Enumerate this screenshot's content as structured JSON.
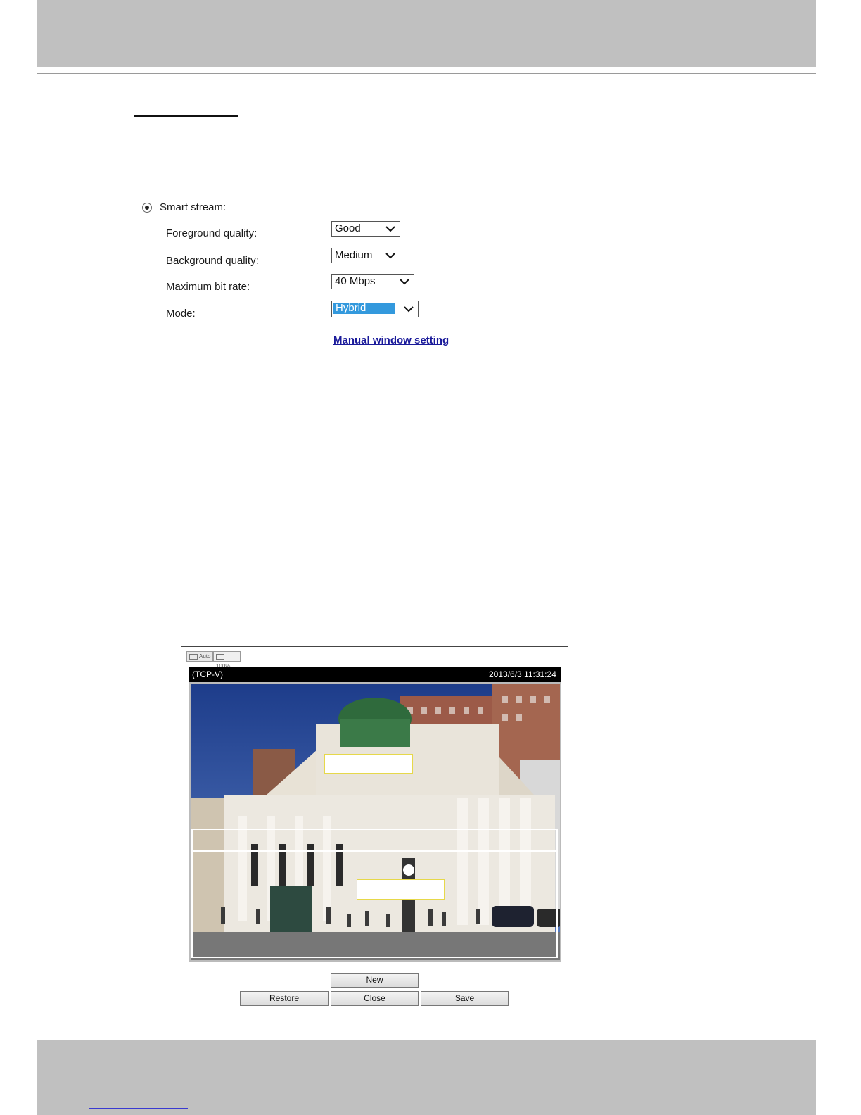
{
  "form": {
    "smart_stream_label": "Smart stream:",
    "fields": [
      {
        "label": "Foreground quality:",
        "value": "Good"
      },
      {
        "label": "Background quality:",
        "value": "Medium"
      },
      {
        "label": "Maximum bit rate:",
        "value": "40 Mbps"
      },
      {
        "label": "Mode:",
        "value": "Hybrid"
      }
    ],
    "manual_link": "Manual window setting"
  },
  "viewer": {
    "size_buttons": [
      "Auto",
      "100%"
    ],
    "protocol": "(TCP-V)",
    "timestamp": "2013/6/3 11:31:24",
    "buttons": {
      "new": "New",
      "restore": "Restore",
      "close": "Close",
      "save": "Save"
    }
  },
  "colors": {
    "header_band": "#c0c0c0",
    "link": "#1a1a9a",
    "selection": "#3399dd",
    "roi_window_border": "#e6d84a"
  }
}
